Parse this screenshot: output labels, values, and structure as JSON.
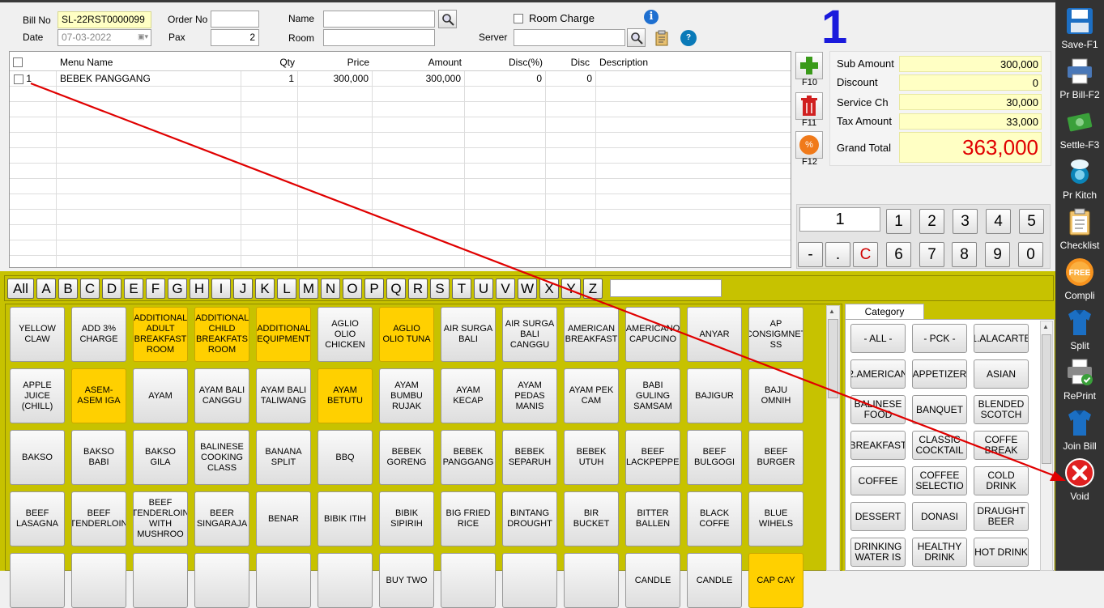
{
  "header": {
    "bill_no_label": "Bill No",
    "bill_no": "SL-22RST0000099",
    "date_label": "Date",
    "date": "07-03-2022",
    "order_no_label": "Order No",
    "order_no": "",
    "pax_label": "Pax",
    "pax": "2",
    "name_label": "Name",
    "name": "",
    "room_label": "Room",
    "room": "",
    "room_charge_label": "Room Charge",
    "server_label": "Server",
    "server": "",
    "table_number": "1"
  },
  "grid": {
    "columns": [
      "Menu Name",
      "Qty",
      "Price",
      "Amount",
      "Disc(%)",
      "Disc",
      "Description"
    ],
    "rows": [
      {
        "no": "1",
        "menu": "BEBEK PANGGANG",
        "qty": "1",
        "price": "300,000",
        "amount": "300,000",
        "disc_pct": "0",
        "disc": "0",
        "desc": ""
      }
    ]
  },
  "side_keys": {
    "add": "F10",
    "delete": "F11",
    "discount": "F12"
  },
  "totals": {
    "sub_amount_label": "Sub Amount",
    "sub_amount": "300,000",
    "discount_label": "Discount",
    "discount": "0",
    "service_label": "Service Ch",
    "service": "30,000",
    "tax_label": "Tax Amount",
    "tax": "33,000",
    "grand_label": "Grand Total",
    "grand": "363,000"
  },
  "keypad": {
    "display": "1",
    "row1": [
      "1",
      "2",
      "3",
      "4",
      "5"
    ],
    "row2": [
      "-",
      ".",
      "C",
      "6",
      "7",
      "8",
      "9",
      "0"
    ]
  },
  "alphabet": [
    "All",
    "A",
    "B",
    "C",
    "D",
    "E",
    "F",
    "G",
    "H",
    "I",
    "J",
    "K",
    "L",
    "M",
    "N",
    "O",
    "P",
    "Q",
    "R",
    "S",
    "T",
    "U",
    "V",
    "W",
    "X",
    "Y",
    "Z"
  ],
  "menu_items": [
    [
      "YELLOW CLAW",
      "ADD 3% CHARGE",
      "ADDITIONAL ADULT BREAKFAST ROOM",
      "ADDITIONAL CHILD BREAKFATS ROOM",
      "ADDITIONAL EQUIPMENT",
      "AGLIO OLIO CHICKEN",
      "AGLIO OLIO TUNA",
      "AIR SURGA BALI",
      "AIR SURGA BALI CANGGU",
      "AMERICAN BREAKFAST",
      "AMERICANO CAPUCINO",
      "ANYAR",
      "AP CONSIGMNET SS"
    ],
    [
      "APPLE JUICE (CHILL)",
      "ASEM-ASEM IGA",
      "AYAM",
      "AYAM BALI CANGGU",
      "AYAM BALI TALIWANG",
      "AYAM BETUTU",
      "AYAM BUMBU RUJAK",
      "AYAM KECAP",
      "AYAM PEDAS MANIS",
      "AYAM PEK CAM",
      "BABI GULING SAMSAM",
      "BAJIGUR",
      "BAJU OMNIH"
    ],
    [
      "BAKSO",
      "BAKSO BABI",
      "BAKSO GILA",
      "BALINESE COOKING CLASS",
      "BANANA SPLIT",
      "BBQ",
      "BEBEK GORENG",
      "BEBEK PANGGANG",
      "BEBEK SEPARUH",
      "BEBEK UTUH",
      "BEEF BLACKPEPPER",
      "BEEF BULGOGI",
      "BEEF BURGER"
    ],
    [
      "BEEF LASAGNA",
      "BEEF TENDERLOIN",
      "BEEF TENDERLOIN WITH MUSHROO",
      "BEER SINGARAJA",
      "BENAR",
      "BIBIK ITIH",
      "BIBIK SIPIRIH",
      "BIG FRIED RICE",
      "BINTANG DROUGHT",
      "BIR BUCKET",
      "BITTER BALLEN",
      "BLACK COFFE",
      "BLUE WIHELS"
    ],
    [
      "",
      "",
      "",
      "",
      "",
      "",
      "BUY TWO",
      "",
      "",
      "",
      "CANDLE",
      "CANDLE",
      "CAP CAY"
    ]
  ],
  "menu_yellow": [
    [
      2,
      3,
      4,
      6
    ],
    [
      1,
      5
    ],
    [],
    [],
    [
      12
    ]
  ],
  "category": {
    "title": "Category",
    "items": [
      "- ALL -",
      "- PCK -",
      "1.ALACARTE",
      "2.AMERICAN",
      "APPETIZER",
      "ASIAN",
      "BALINESE FOOD",
      "BANQUET",
      "BLENDED SCOTCH",
      "BREAKFAST",
      "CLASSIC COCKTAIL",
      "COFFE BREAK",
      "COFFEE",
      "COFFEE SELECTIO",
      "COLD DRINK",
      "DESSERT",
      "DONASI",
      "DRAUGHT BEER",
      "DRINKING WATER IS",
      "HEALTHY DRINK",
      "HOT DRINK"
    ]
  },
  "toolbar": [
    {
      "label": "Save-F1",
      "icon": "floppy-disk-icon"
    },
    {
      "label": "Pr Bill-F2",
      "icon": "printer-icon"
    },
    {
      "label": "Settle-F3",
      "icon": "money-icon"
    },
    {
      "label": "Pr Kitch",
      "icon": "chef-icon"
    },
    {
      "label": "Checklist",
      "icon": "clipboard-icon"
    },
    {
      "label": "Compli",
      "icon": "free-badge-icon"
    },
    {
      "label": "Split",
      "icon": "shirt-icon"
    },
    {
      "label": "RePrint",
      "icon": "reprint-icon"
    },
    {
      "label": "Join Bill",
      "icon": "shirt-icon"
    },
    {
      "label": "Void",
      "icon": "void-x-icon"
    }
  ],
  "colors": {
    "accent_blue": "#1a1adc",
    "olive_bg": "#c7c200",
    "highlight_yellow": "#ffd000",
    "total_bg": "#ffffc4",
    "grand_red": "#e00000",
    "arrow_red": "#e00000"
  }
}
